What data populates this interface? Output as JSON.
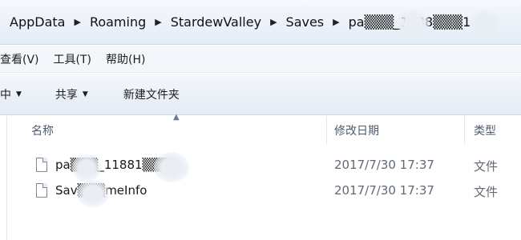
{
  "address_bar": {
    "crumbs": [
      {
        "label": "AppData"
      },
      {
        "label": "Roaming"
      },
      {
        "label": "StardewValley"
      },
      {
        "label": "Saves"
      },
      {
        "label": "pa▒▒▒_1188▒▒▒1"
      }
    ]
  },
  "menu": {
    "items": [
      {
        "label": "查看(V)"
      },
      {
        "label": "工具(T)"
      },
      {
        "label": "帮助(H)"
      }
    ]
  },
  "toolbar": {
    "organize_partial": "中",
    "share_label": "共享",
    "new_folder_label": "新建文件夹"
  },
  "file_list": {
    "columns": {
      "name": "名称",
      "modified": "修改日期",
      "type": "类型"
    },
    "rows": [
      {
        "name": "pa▒▒▒_11881▒▒▒",
        "modified": "2017/7/30 17:37",
        "type": "文件"
      },
      {
        "name": "Sav▒▒▒meInfo",
        "modified": "2017/7/30 17:37",
        "type": "文件"
      }
    ]
  }
}
